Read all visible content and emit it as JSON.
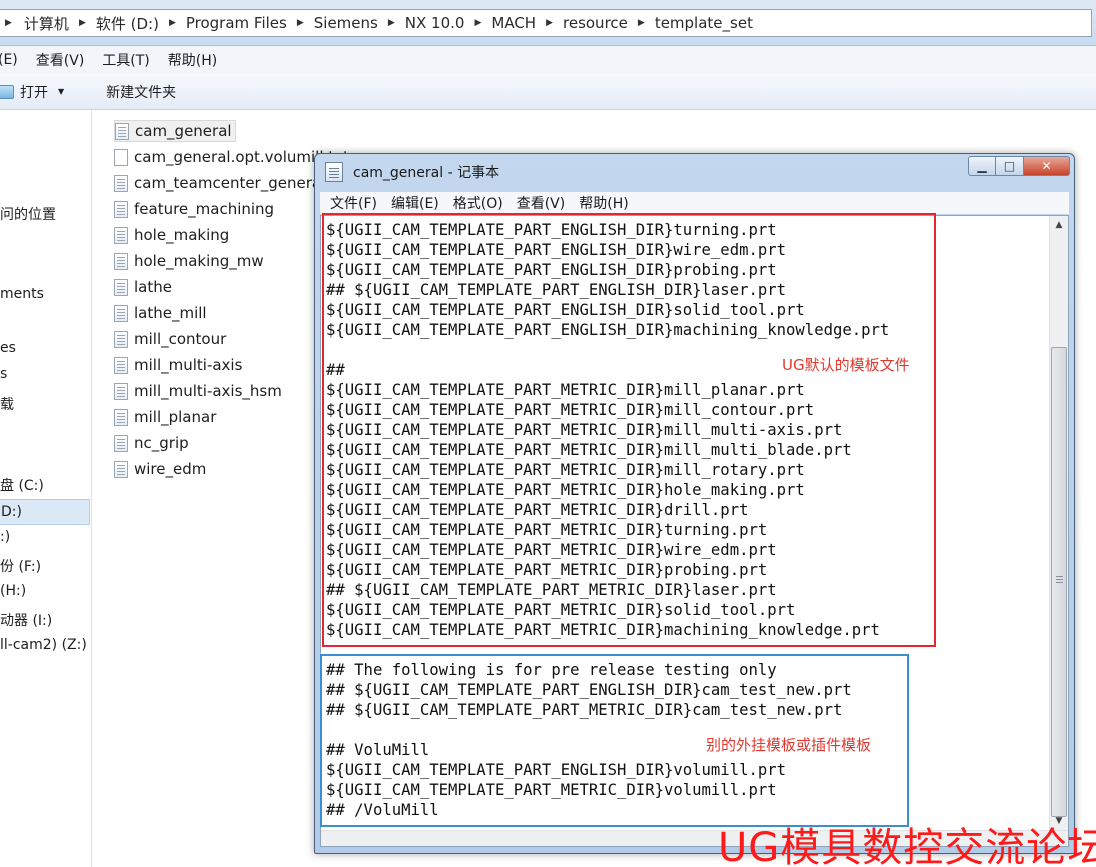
{
  "explorer": {
    "breadcrumb": [
      "计算机",
      "软件 (D:)",
      "Program Files",
      "Siemens",
      "NX 10.0",
      "MACH",
      "resource",
      "template_set"
    ],
    "menu": [
      "(E)",
      "查看(V)",
      "工具(T)",
      "帮助(H)"
    ],
    "toolbar": {
      "open_label": "打开",
      "new_folder_label": "新建文件夹"
    },
    "nav_items": [
      "问的位置",
      "ments",
      "es",
      "s",
      "载",
      "盘 (C:)",
      "D:)",
      ":)",
      "份 (F:)",
      "(H:)",
      "动器 (I:)",
      "ll-cam2) (Z:)"
    ],
    "files": [
      "cam_general",
      "cam_general.opt.volumill.txt",
      "cam_teamcenter_general",
      "feature_machining",
      "hole_making",
      "hole_making_mw",
      "lathe",
      "lathe_mill",
      "mill_contour",
      "mill_multi-axis",
      "mill_multi-axis_hsm",
      "mill_planar",
      "nc_grip",
      "wire_edm"
    ]
  },
  "notepad": {
    "title": "cam_general - 记事本",
    "menu": [
      "文件(F)",
      "编辑(E)",
      "格式(O)",
      "查看(V)",
      "帮助(H)"
    ],
    "lines": [
      "${UGII_CAM_TEMPLATE_PART_ENGLISH_DIR}turning.prt",
      "${UGII_CAM_TEMPLATE_PART_ENGLISH_DIR}wire_edm.prt",
      "${UGII_CAM_TEMPLATE_PART_ENGLISH_DIR}probing.prt",
      "## ${UGII_CAM_TEMPLATE_PART_ENGLISH_DIR}laser.prt",
      "${UGII_CAM_TEMPLATE_PART_ENGLISH_DIR}solid_tool.prt",
      "${UGII_CAM_TEMPLATE_PART_ENGLISH_DIR}machining_knowledge.prt",
      "",
      "##",
      "${UGII_CAM_TEMPLATE_PART_METRIC_DIR}mill_planar.prt",
      "${UGII_CAM_TEMPLATE_PART_METRIC_DIR}mill_contour.prt",
      "${UGII_CAM_TEMPLATE_PART_METRIC_DIR}mill_multi-axis.prt",
      "${UGII_CAM_TEMPLATE_PART_METRIC_DIR}mill_multi_blade.prt",
      "${UGII_CAM_TEMPLATE_PART_METRIC_DIR}mill_rotary.prt",
      "${UGII_CAM_TEMPLATE_PART_METRIC_DIR}hole_making.prt",
      "${UGII_CAM_TEMPLATE_PART_METRIC_DIR}drill.prt",
      "${UGII_CAM_TEMPLATE_PART_METRIC_DIR}turning.prt",
      "${UGII_CAM_TEMPLATE_PART_METRIC_DIR}wire_edm.prt",
      "${UGII_CAM_TEMPLATE_PART_METRIC_DIR}probing.prt",
      "## ${UGII_CAM_TEMPLATE_PART_METRIC_DIR}laser.prt",
      "${UGII_CAM_TEMPLATE_PART_METRIC_DIR}solid_tool.prt",
      "${UGII_CAM_TEMPLATE_PART_METRIC_DIR}machining_knowledge.prt",
      "",
      "## The following is for pre release testing only",
      "## ${UGII_CAM_TEMPLATE_PART_ENGLISH_DIR}cam_test_new.prt",
      "## ${UGII_CAM_TEMPLATE_PART_METRIC_DIR}cam_test_new.prt",
      "",
      "## VoluMill",
      "${UGII_CAM_TEMPLATE_PART_ENGLISH_DIR}volumill.prt",
      "${UGII_CAM_TEMPLATE_PART_METRIC_DIR}volumill.prt",
      "## /VoluMill"
    ]
  },
  "annotations": {
    "ug_default_label": "UG默认的模板文件",
    "plugin_label": "别的外挂模板或插件模板",
    "watermark": "UG模具数控交流论坛",
    "red_color": "#e5262e",
    "blue_color": "#3a8fd3"
  }
}
